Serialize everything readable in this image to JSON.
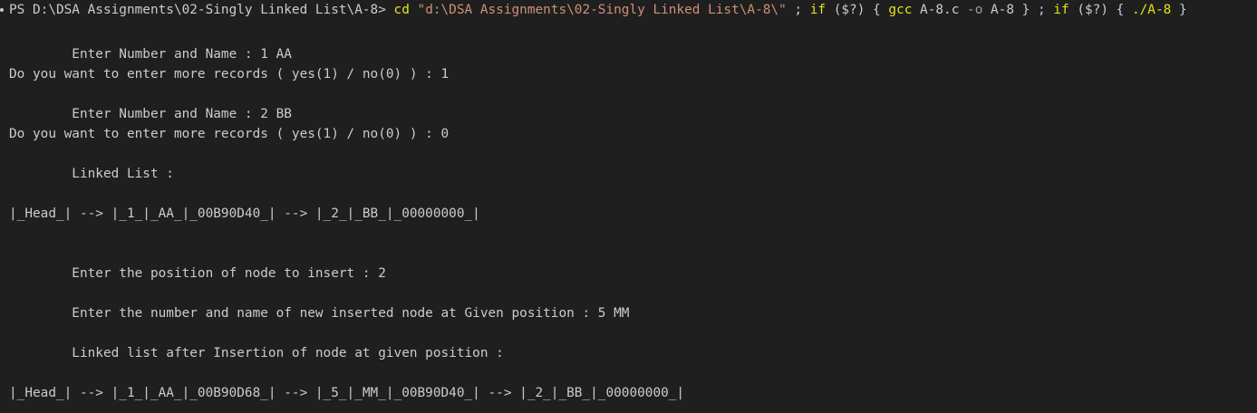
{
  "terminal": {
    "prompt": "PS D:\\DSA Assignments\\02-Singly Linked List\\A-8> ",
    "cmd": {
      "cd": "cd",
      "path": "\"d:\\DSA Assignments\\02-Singly Linked List\\A-8\\\"",
      "sep1": " ; ",
      "if1": "if",
      "cond1": " ($?) { ",
      "gcc": "gcc",
      "gcc_args_a": " A-8.c ",
      "gcc_flag": "-o",
      "gcc_args_b": " A-8 } ; ",
      "if2": "if",
      "cond2": " ($?) { ",
      "run": "./A-8",
      "end": " }"
    },
    "lines": {
      "l1": "        Enter Number and Name : 1 AA",
      "l2": "Do you want to enter more records ( yes(1) / no(0) ) : 1",
      "l3": "        Enter Number and Name : 2 BB",
      "l4": "Do you want to enter more records ( yes(1) / no(0) ) : 0",
      "l5": "        Linked List :",
      "l6": "|_Head_| --> |_1_|_AA_|_00B90D40_| --> |_2_|_BB_|_00000000_|",
      "l7": "        Enter the position of node to insert : 2",
      "l8": "        Enter the number and name of new inserted node at Given position : 5 MM",
      "l9": "        Linked list after Insertion of node at given position :",
      "l10": "|_Head_| --> |_1_|_AA_|_00B90D68_| --> |_5_|_MM_|_00B90D40_| --> |_2_|_BB_|_00000000_|"
    },
    "colors": {
      "background": "#1f1f1f",
      "text": "#cccccc",
      "command": "#e5e510",
      "string": "#ce9178",
      "flag": "#9d9d9d"
    }
  }
}
